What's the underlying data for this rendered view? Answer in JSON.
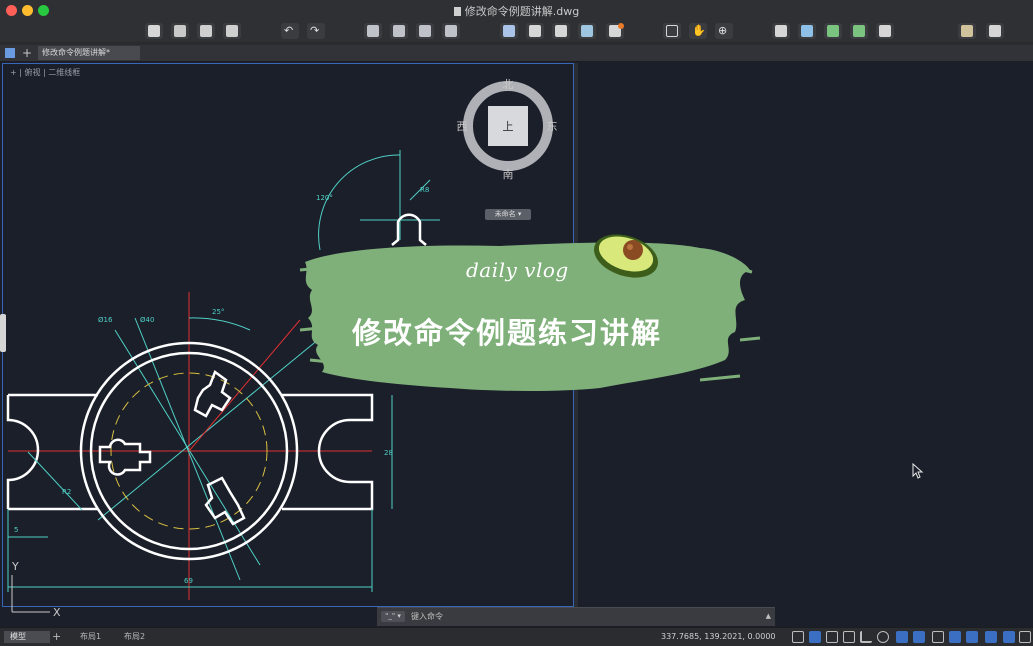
{
  "window": {
    "title": "修改命令例题讲解.dwg"
  },
  "tabs": {
    "doc_tab_label": "修改命令例题讲解*"
  },
  "viewport": {
    "label": "+ | 俯视 | 二维线框",
    "view_cube": {
      "north": "北",
      "south": "南",
      "east": "东",
      "west": "西",
      "top_face": "上"
    },
    "ucs_tag": "未命名 ▾"
  },
  "drawing": {
    "dims": {
      "d28": "28",
      "d69": "69",
      "d5": "5",
      "a25": "25°",
      "a120": "120°",
      "r8": "R8",
      "d16": "Ø16",
      "d40": "Ø40",
      "r2": "R2"
    },
    "axis_y": "Y",
    "axis_x": "X"
  },
  "banner": {
    "subtitle": "daily vlog",
    "title": "修改命令例题练习讲解"
  },
  "command_line": {
    "button": "\"_\" ▾",
    "prompt": "键入命令"
  },
  "status_bar": {
    "layout_tabs": [
      "模型",
      "+",
      "布局1",
      "布局2"
    ],
    "coordinates": "337.7685, 139.2021, 0.0000"
  },
  "colors": {
    "accent": "#3a66b8",
    "banner_green": "#7fb07a",
    "drawing_white": "#ffffff",
    "dim_cyan": "#4fd1c5",
    "center_red": "#e03030",
    "dash_yellow": "#d8c040"
  }
}
